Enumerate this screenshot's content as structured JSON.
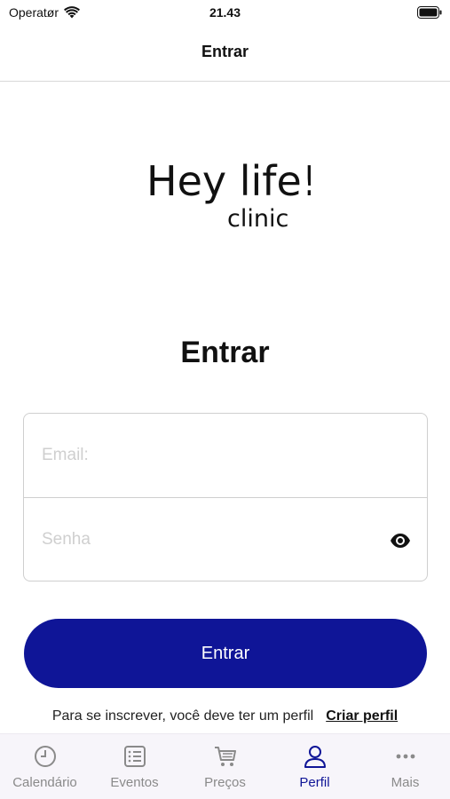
{
  "status_bar": {
    "carrier": "Operatør",
    "time": "21.43"
  },
  "nav": {
    "title": "Entrar"
  },
  "logo": {
    "line1": "Hey life!",
    "line2": "clinic"
  },
  "login": {
    "heading": "Entrar",
    "email_placeholder": "Email:",
    "password_placeholder": "Senha",
    "submit_label": "Entrar"
  },
  "signup": {
    "text": "Para se inscrever, você deve ter um perfil",
    "link": "Criar perfil"
  },
  "tabs": [
    {
      "label": "Calendário",
      "icon": "clock-icon",
      "active": false
    },
    {
      "label": "Eventos",
      "icon": "list-icon",
      "active": false
    },
    {
      "label": "Preços",
      "icon": "cart-icon",
      "active": false
    },
    {
      "label": "Perfil",
      "icon": "person-icon",
      "active": true
    },
    {
      "label": "Mais",
      "icon": "more-dots-icon",
      "active": false
    }
  ],
  "colors": {
    "primary": "#0f1597",
    "inactive_tab": "#8a8a8a",
    "tab_bar_bg": "#f7f5fa"
  }
}
